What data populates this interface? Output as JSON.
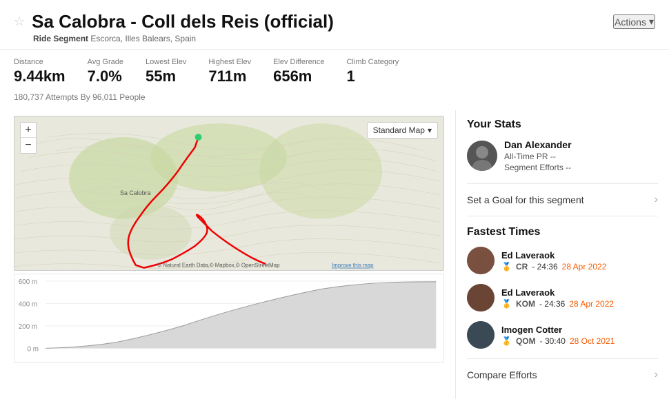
{
  "header": {
    "star_icon": "☆",
    "title": "Sa Calobra - Coll dels Reis (official)",
    "actions_label": "Actions",
    "actions_chevron": "▾",
    "segment_type_label": "Ride Segment",
    "segment_location": "Escorca, Illes Balears, Spain"
  },
  "stats": [
    {
      "label": "Distance",
      "value": "9.44km"
    },
    {
      "label": "Avg Grade",
      "value": "7.0%"
    },
    {
      "label": "Lowest Elev",
      "value": "55m"
    },
    {
      "label": "Highest Elev",
      "value": "711m"
    },
    {
      "label": "Elev Difference",
      "value": "656m"
    },
    {
      "label": "Climb Category",
      "value": "1"
    }
  ],
  "attempts": "180,737 Attempts By 96,011 People",
  "map": {
    "plus_label": "+",
    "minus_label": "−",
    "map_type_label": "Standard Map",
    "map_type_chevron": "▾",
    "attribution": "© Natural Earth Data,© Mapbox,© OpenStreetMap",
    "improve_label": "Improve this map"
  },
  "your_stats": {
    "title": "Your Stats",
    "user_name": "Dan Alexander",
    "all_time_pr": "All-Time PR  --",
    "segment_efforts": "Segment Efforts  --"
  },
  "goal": {
    "text": "Set a Goal for this segment",
    "chevron": "›"
  },
  "fastest_times": {
    "title": "Fastest Times",
    "entries": [
      {
        "name": "Ed Laveraok",
        "medal": "🥇",
        "type": "CR",
        "time": "- 24:36",
        "date": "28 Apr 2022"
      },
      {
        "name": "Ed Laveraok",
        "medal": "🥇",
        "type": "KOM",
        "time": "- 24:36",
        "date": "28 Apr 2022"
      },
      {
        "name": "Imogen Cotter",
        "medal": "🥇",
        "type": "QOM",
        "time": "- 30:40",
        "date": "28 Oct 2021"
      }
    ]
  },
  "compare": {
    "text": "Compare Efforts",
    "chevron": "›"
  }
}
